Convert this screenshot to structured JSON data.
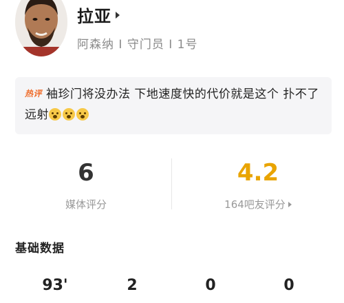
{
  "player": {
    "name": "拉亚",
    "meta": "阿森纳 I 守门员 I 1号"
  },
  "hot_comment": {
    "tag": "热评",
    "text": "袖珍门将没办法 下地速度快的代价就是这个 扑不了远射",
    "emoji_count": 3
  },
  "ratings": {
    "media": {
      "value": "6",
      "label": "媒体评分"
    },
    "fans": {
      "value": "4.2",
      "label": "164吧友评分"
    }
  },
  "basic_stats": {
    "title": "基础数据",
    "values": [
      "93'",
      "2",
      "0",
      "0"
    ]
  }
}
